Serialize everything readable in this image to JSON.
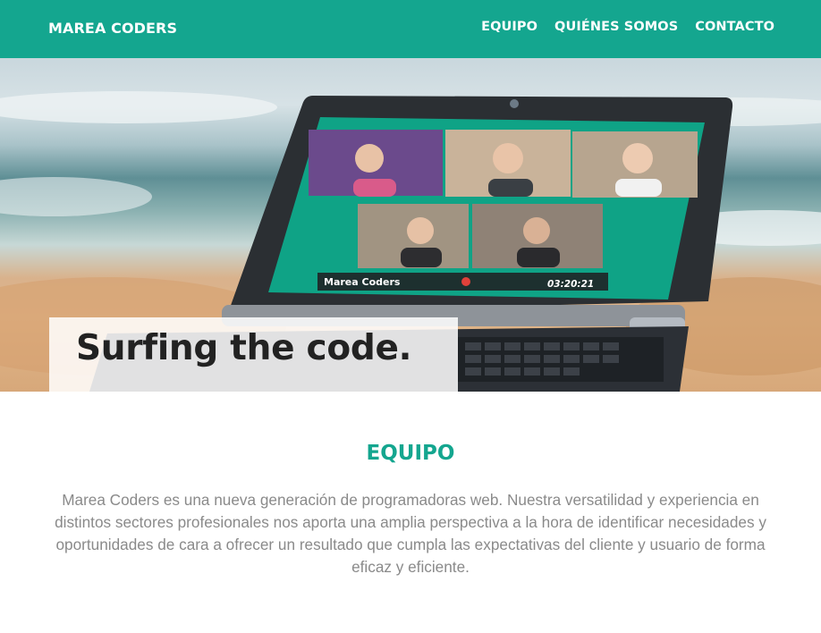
{
  "navbar": {
    "brand": "MAREA CODERS",
    "links": [
      "EQUIPO",
      "QUIÉNES SOMOS",
      "CONTACTO"
    ],
    "background": "#14a68f"
  },
  "hero": {
    "image": "laptop-on-beach-video-call",
    "call_label": "Marea Coders",
    "call_time": "03:20:21",
    "tagline": "Surfing the code."
  },
  "section": {
    "title": "EQUIPO",
    "text": "Marea Coders es una nueva generación de programadoras web. Nuestra versatilidad y experiencia en distintos sectores profesionales nos aporta una amplia perspectiva a la hora de identificar necesidades y oportunidades de cara a ofrecer un resultado que cumpla las expectativas del cliente y usuario de forma eficaz y eficiente.",
    "title_color": "#14a68f"
  }
}
